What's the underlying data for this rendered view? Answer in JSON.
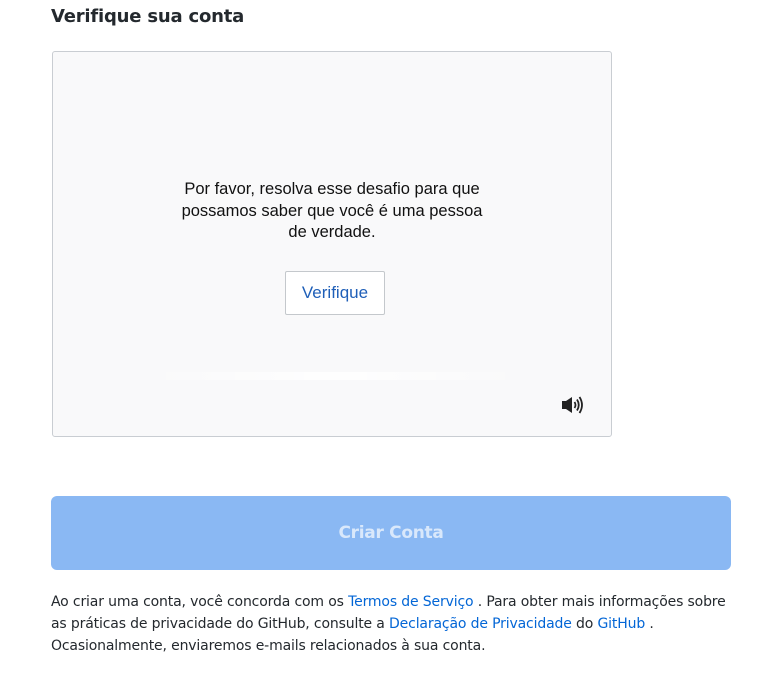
{
  "heading": "Verifique sua conta",
  "captcha": {
    "message_lines": [
      "Por favor, resolva esse desafio para que",
      "possamos saber que você é uma pessoa",
      "de verdade."
    ],
    "verify_label": "Verifique",
    "audio_icon": "speaker-icon"
  },
  "create_account_label": "Criar Conta",
  "legal": {
    "text1": "Ao criar uma conta, você concorda com os ",
    "terms_link": "Termos de Serviço",
    "text2": " . Para obter mais informações sobre as práticas de privacidade do GitHub, consulte a ",
    "privacy_link": "Declaração de Privacidade",
    "text3": " do ",
    "github_link": "GitHub",
    "text4": " . Ocasionalmente, enviaremos e-mails relacionados à sua conta."
  },
  "colors": {
    "create_button_bg": "#8ab8f3",
    "create_button_text": "#d9e8fb",
    "link": "#0366d6",
    "verify_text": "#1f5fb8"
  }
}
